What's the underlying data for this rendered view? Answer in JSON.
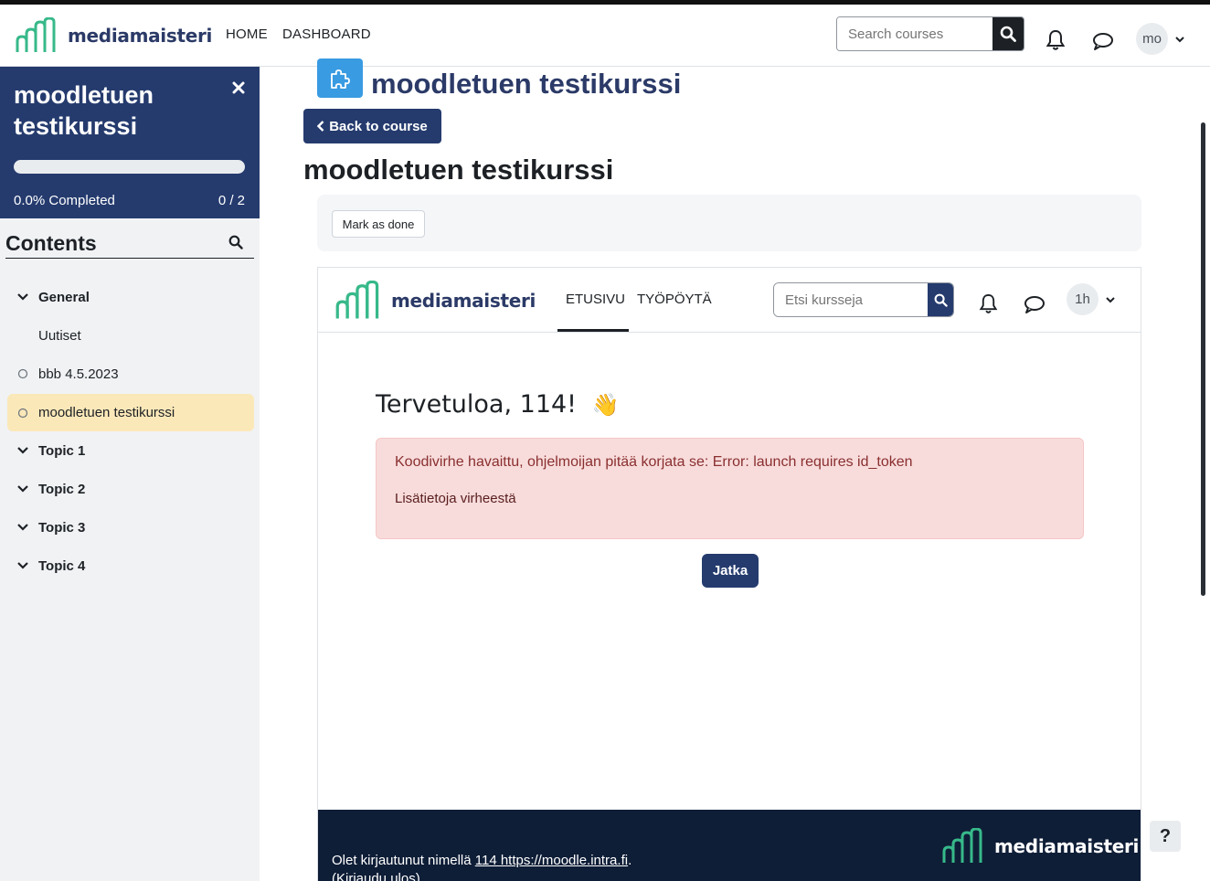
{
  "colors": {
    "brand_navy": "#253b6e",
    "accent_green": "#37b98a",
    "error_bg": "#f8dcdc",
    "active_toc": "#fbe8b9"
  },
  "header": {
    "logo_text": "mediamaisteri",
    "nav": [
      {
        "label": "HOME"
      },
      {
        "label": "DASHBOARD"
      }
    ],
    "search": {
      "placeholder": "Search courses",
      "icon": "search-icon"
    },
    "notification_icon": "bell-icon",
    "messages_icon": "chat-icon",
    "user": {
      "initials": "mo",
      "menu_icon": "chevron-down-icon"
    }
  },
  "drawer": {
    "title": "moodletuen testikurssi",
    "close_icon": "close-icon",
    "progress": {
      "percent": 0.0,
      "label": "0.0% Completed",
      "count": "0 / 2"
    },
    "contents_label": "Contents",
    "items": [
      {
        "label": "General",
        "type": "section"
      },
      {
        "label": "Uutiset",
        "type": "activity-none"
      },
      {
        "label": "bbb 4.5.2023",
        "type": "activity"
      },
      {
        "label": "moodletuen testikurssi",
        "type": "activity-active"
      },
      {
        "label": "Topic 1",
        "type": "section"
      },
      {
        "label": "Topic 2",
        "type": "section"
      },
      {
        "label": "Topic 3",
        "type": "section"
      },
      {
        "label": "Topic 4",
        "type": "section"
      }
    ]
  },
  "main": {
    "badge_icon": "puzzle-icon",
    "header_title": "moodletuen testikurssi",
    "back_label": "Back to course",
    "title": "moodletuen testikurssi",
    "mark_done_label": "Mark as done"
  },
  "embed": {
    "logo_text": "mediamaisteri",
    "nav": [
      {
        "label": "ETUSIVU"
      },
      {
        "label": "TYÖPÖYTÄ"
      }
    ],
    "search_placeholder": "Etsi kursseja",
    "user_initials": "1h",
    "welcome": "Tervetuloa, 114!",
    "wave": "👋",
    "error_message": "Koodivirhe havaittu, ohjelmoijan pitää korjata se: Error: launch requires id_token",
    "error_more": "Lisätietoja virheestä",
    "continue_label": "Jatka",
    "footer": {
      "logged_in_prefix": "Olet kirjautunut nimellä ",
      "user_link": "114 https://moodle.intra.fi",
      "suffix": ".",
      "logout": "(Kirjaudu ulos)",
      "logo_text": "mediamaisteri"
    }
  },
  "help_label": "?"
}
